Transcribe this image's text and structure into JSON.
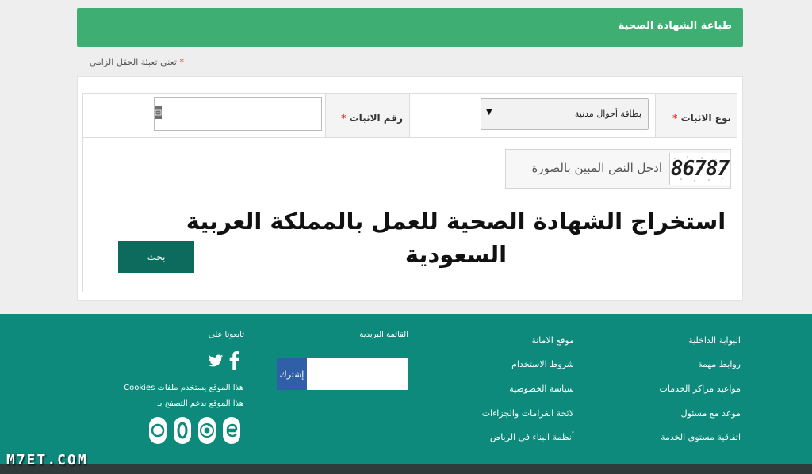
{
  "header": {
    "title": "طباعة الشهادة الصحية"
  },
  "form": {
    "required_star": "*",
    "required_note": "تعني تعبئة الحقل الزامي",
    "doctype_label": "نوع الاثبات",
    "doctype_selected": "بطاقة أحوال مدنية",
    "doctype_arrow": "▼",
    "idnum_label": "رقم الاثبات",
    "idnum_value": "",
    "captcha_placeholder": "ادخل النص المبين بالصورة",
    "captcha_code": "86787",
    "search_label": "بحث"
  },
  "overlay": {
    "title": "استخراج الشهادة الصحية للعمل بالمملكة العربية السعودية"
  },
  "footer": {
    "col1": [
      "البوابة الداخلية",
      "روابط مهمة",
      "مواعيد مراكز الخدمات",
      "موعد مع مسئول",
      "اتفاقية مستوى الخدمة"
    ],
    "col2": [
      "موقع الامانة",
      "شروط الاستخدام",
      "سياسة الخصوصية",
      "لائحة الغرامات والجزاءات",
      "أنظمة البناء في الرياض"
    ],
    "newsletter_heading": "القائمة البريدية",
    "subscribe_label": "إشترك",
    "follow_heading": "تابعونا على",
    "cookies_note": "هذا الموقع يستخدم ملفات Cookies",
    "browsers_note": "هذا الموقع يدعم التصفح بـ",
    "icons": [
      "twitter-icon",
      "facebook-icon",
      "firefox-icon",
      "opera-icon",
      "chrome-icon",
      "ie-icon"
    ]
  },
  "watermark": "M7ET.COM",
  "colors": {
    "header_green": "#3fae73",
    "footer_teal": "#0d8a7c",
    "button_dark_teal": "#0d6b5e",
    "subscribe_blue": "#2f5fa7",
    "required_red": "#d9342b"
  }
}
